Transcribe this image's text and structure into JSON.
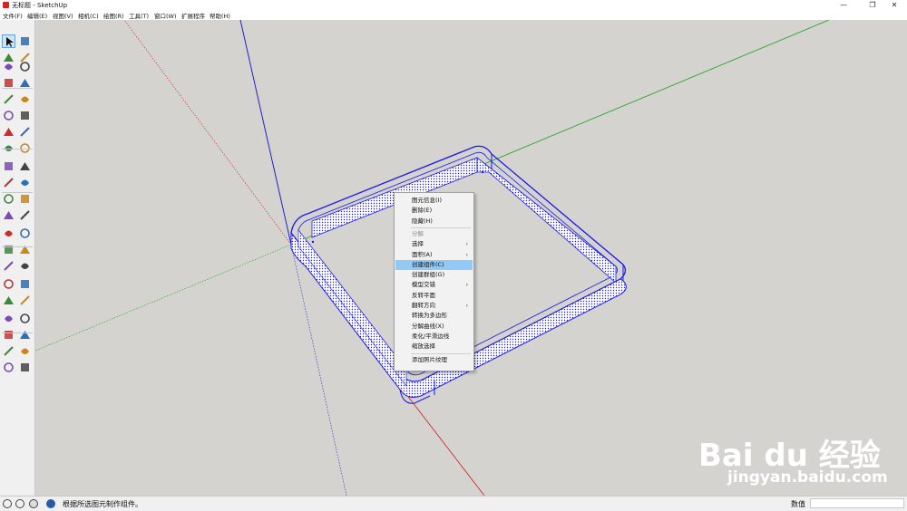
{
  "window": {
    "title": "无标题 - SketchUp",
    "minimize_glyph": "—",
    "maximize_glyph": "❐",
    "close_glyph": "✕"
  },
  "menu": [
    {
      "label": "文件(F)"
    },
    {
      "label": "编辑(E)"
    },
    {
      "label": "视图(V)"
    },
    {
      "label": "相机(C)"
    },
    {
      "label": "绘图(R)"
    },
    {
      "label": "工具(T)"
    },
    {
      "label": "窗口(W)"
    },
    {
      "label": "扩展程序"
    },
    {
      "label": "帮助(H)"
    }
  ],
  "toolbar": {
    "tools": [
      "select-icon",
      "eraser-icon",
      "paint-bucket-icon",
      "eraser-pink-icon",
      "pencil-icon",
      "freehand-icon",
      "rectangle-icon",
      "rotated-rectangle-icon",
      "circle-icon",
      "polygon-icon",
      "arc-icon",
      "two-point-arc-icon",
      "three-point-arc-icon",
      "pie-icon",
      "move-icon",
      "push-pull-icon",
      "rotate-icon",
      "follow-me-icon",
      "scale-icon",
      "offset-icon",
      "tape-measure-icon",
      "dimension-icon",
      "protractor-icon",
      "text-icon",
      "axes-icon",
      "3d-text-icon",
      "orbit-icon",
      "pan-icon",
      "zoom-icon",
      "zoom-window-icon",
      "zoom-extents-icon",
      "previous-view-icon",
      "position-camera-icon",
      "look-around-icon",
      "walk-icon",
      "section-plane-icon",
      "warehouse-icon",
      "extension-warehouse-icon",
      "house-icon",
      "house-section-icon",
      "house-outline-icon",
      "house-roof-icon"
    ]
  },
  "context_menu": {
    "items": [
      {
        "label": "图元信息(I)",
        "submenu": false,
        "enabled": true,
        "highlighted": false
      },
      {
        "label": "删除(E)",
        "submenu": false,
        "enabled": true,
        "highlighted": false
      },
      {
        "label": "隐藏(H)",
        "submenu": false,
        "enabled": true,
        "highlighted": false
      },
      {
        "separator": true
      },
      {
        "label": "分解",
        "submenu": false,
        "enabled": false,
        "highlighted": false
      },
      {
        "label": "选择",
        "submenu": true,
        "enabled": true,
        "highlighted": false
      },
      {
        "label": "面积(A)",
        "submenu": true,
        "enabled": true,
        "highlighted": false
      },
      {
        "label": "创建组件(C)",
        "submenu": false,
        "enabled": true,
        "highlighted": true
      },
      {
        "label": "创建群组(G)",
        "submenu": false,
        "enabled": true,
        "highlighted": false
      },
      {
        "label": "模型交错",
        "submenu": true,
        "enabled": true,
        "highlighted": false
      },
      {
        "label": "反转平面",
        "submenu": false,
        "enabled": true,
        "highlighted": false
      },
      {
        "label": "翻转方向",
        "submenu": true,
        "enabled": true,
        "highlighted": false
      },
      {
        "label": "转换为多边形",
        "submenu": false,
        "enabled": true,
        "highlighted": false
      },
      {
        "label": "分解曲线(X)",
        "submenu": false,
        "enabled": true,
        "highlighted": false
      },
      {
        "label": "柔化/平滑边线",
        "submenu": false,
        "enabled": true,
        "highlighted": false
      },
      {
        "label": "缩放选择",
        "submenu": false,
        "enabled": true,
        "highlighted": false
      },
      {
        "separator": true
      },
      {
        "label": "添加照片纹理",
        "submenu": false,
        "enabled": true,
        "highlighted": false
      }
    ],
    "submenu_glyph": "›"
  },
  "watermark": {
    "logo": "Bai du 经验",
    "url": "jingyan.baidu.com"
  },
  "statusbar": {
    "icons": [
      "info-icon",
      "help-circle-icon",
      "user-icon",
      "geo-location-icon"
    ],
    "message": "根据所选图元制作组件。",
    "measurements_label": "数值",
    "measurements_value": ""
  },
  "colors": {
    "viewport_bg": "#d4d3cf",
    "selection_blue": "#1a1ae6",
    "axis_red": "#d01a1a",
    "axis_green": "#18a018",
    "axis_blue": "#2020d0",
    "menu_highlight": "#91c9f7"
  }
}
